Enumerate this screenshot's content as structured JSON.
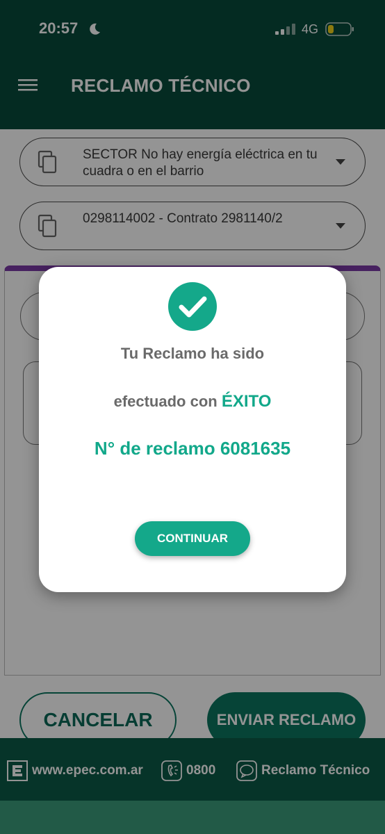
{
  "status_bar": {
    "time": "20:57",
    "network": "4G",
    "icons": [
      "moon-icon",
      "signal-icon",
      "battery-icon"
    ]
  },
  "app_bar": {
    "title": "RECLAMO TÉCNICO",
    "menu_icon": "menu-icon"
  },
  "form": {
    "sector_select": {
      "value": "SECTOR  No hay energía eléctrica en tu cuadra o en el barrio",
      "icon": "copy-icon"
    },
    "contract_select": {
      "value": "0298114002 - Contrato 2981140/2",
      "icon": "copy-icon"
    }
  },
  "actions": {
    "cancel_label": "CANCELAR",
    "send_label": "ENVIAR RECLAMO"
  },
  "footer": {
    "website": "www.epec.com.ar",
    "phone": "0800",
    "chat": "Reclamo Técnico"
  },
  "dialog": {
    "icon": "check-circle-icon",
    "line1": "Tu Reclamo ha sido",
    "line2_prefix": "efectuado con ",
    "line2_highlight": "ÉXITO",
    "claim_number": "N° de reclamo 6081635",
    "continue_label": "CONTINUAR"
  },
  "colors": {
    "app_bar": "#084a3c",
    "accent": "#14a88a",
    "panel_top_border": "#7a3aa6",
    "footer": "#0c5a48"
  }
}
